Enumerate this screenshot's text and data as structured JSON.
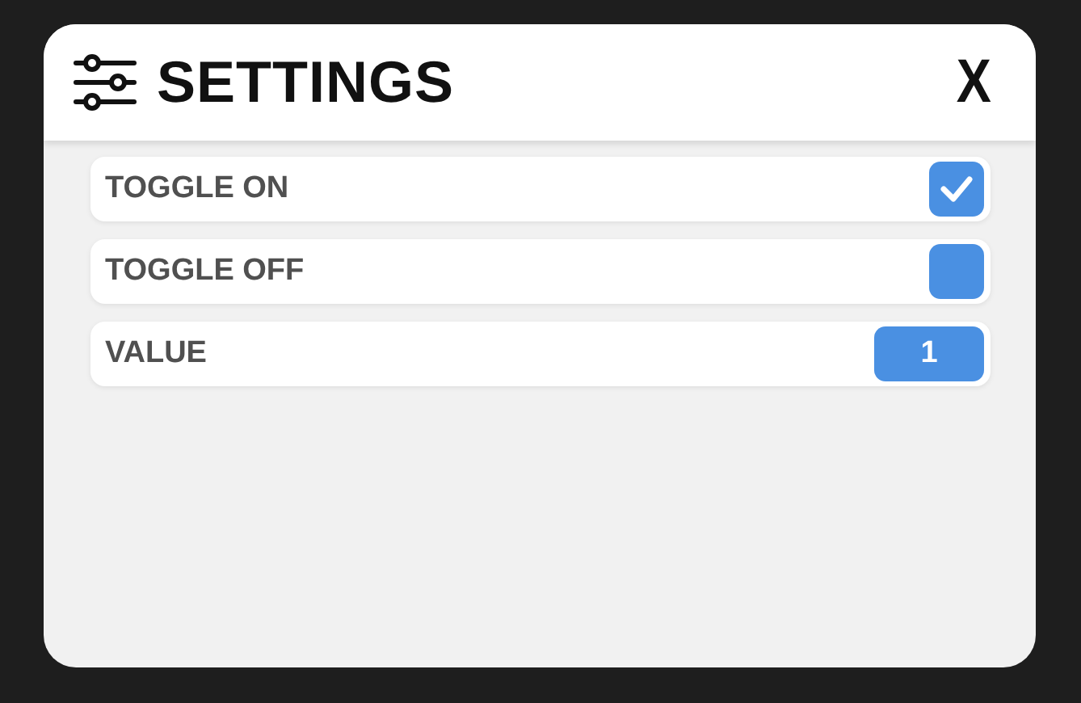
{
  "dialog": {
    "title": "SETTINGS",
    "close": "X"
  },
  "rows": [
    {
      "kind": "toggle",
      "label": "TOGGLE ON",
      "checked": true
    },
    {
      "kind": "toggle",
      "label": "TOGGLE OFF",
      "checked": false
    },
    {
      "kind": "value",
      "label": "VALUE",
      "value": "1"
    }
  ]
}
